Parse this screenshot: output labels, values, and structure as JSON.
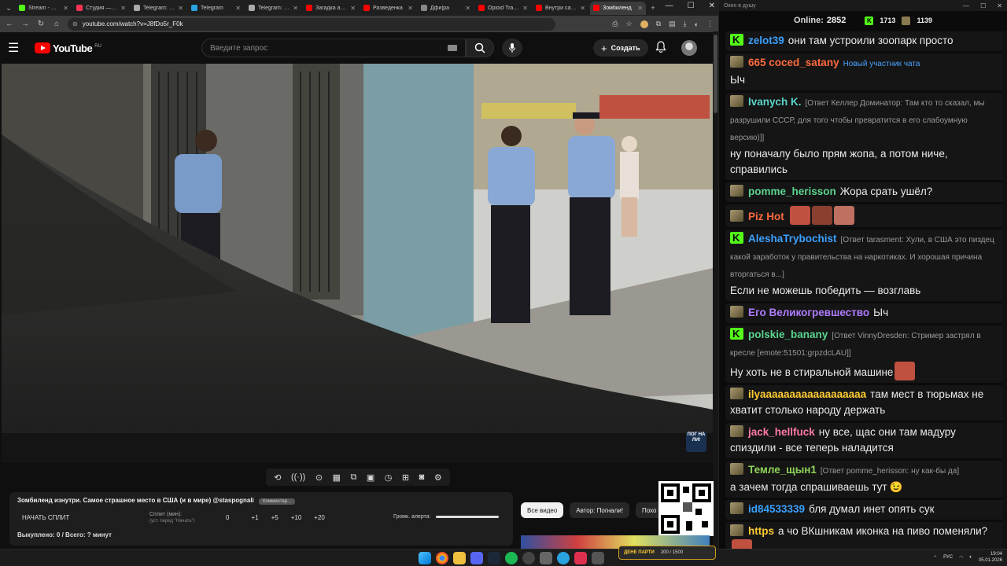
{
  "browser": {
    "tabs": [
      {
        "label": "Stream - Kick",
        "color": "#53fc18"
      },
      {
        "label": "Студия — YouTube",
        "color": "#ff3355"
      },
      {
        "label": "Telegram: View",
        "color": "#aaaaaa"
      },
      {
        "label": "Telegram",
        "color": "#2aa3e0"
      },
      {
        "label": "Telegram: View",
        "color": "#aaaaaa"
      },
      {
        "label": "Загадка арест",
        "color": "#ff0000"
      },
      {
        "label": "Разведенка",
        "color": "#ff0000"
      },
      {
        "label": "Дфи|ра",
        "color": "#888888"
      },
      {
        "label": "Opioid Tragedy",
        "color": "#ff0000"
      },
      {
        "label": "Внутри самой",
        "color": "#ff0000"
      },
      {
        "label": "Зомбиленд",
        "color": "#ff0000"
      }
    ],
    "url": "youtube.com/watch?v=J8fDo5r_F0k"
  },
  "youtube": {
    "region": "RU",
    "search_placeholder": "Введите запрос",
    "create_label": "Создать"
  },
  "video": {
    "watermark": "ПОГ НА ЛИ!"
  },
  "split": {
    "title": "Зомбиленд изнутри. Самое страшное место в США (и в мире) @staspognali",
    "badge": "Комментар...",
    "start_label": "НАЧАТЬ СПЛИТ",
    "split_label": "Сплит (мин):",
    "split_sub": "(уст. перед \"Начать\")",
    "values": [
      "0",
      "+1",
      "+5",
      "+10",
      "+20"
    ],
    "volume_label": "Громк. алерта:",
    "stats": "Выкуплено: 0 / Всего: ? минут"
  },
  "chips": [
    "Все видео",
    "Автор: Погнали!",
    "Похо"
  ],
  "overlay": {
    "name": "ДЕНЕ ПАРТИ",
    "progress": "200 / 1500"
  },
  "chat": {
    "window_title": "Окно в душу",
    "online_label": "Online:",
    "online_count": "2852",
    "kick_count": "1713",
    "other_count": "1139",
    "messages": [
      {
        "badge": "k",
        "user": "zelot39",
        "color": "#3aa0ff",
        "text": "они там устроили зоопарк просто"
      },
      {
        "badge": "sub",
        "user": "665 coced_satany",
        "color": "#ff6b3d",
        "note": "Новый участник чата",
        "text": "Ыч"
      },
      {
        "badge": "sub",
        "user": "Ivanych K.",
        "color": "#5ad4c8",
        "reply": "[Ответ Келлер Доминатор: Там кто то сказал, мы разрушили СССР, для того чтобы превратится в его слабоумную версию)]]",
        "text": "ну поначалу было прям жопа, а потом ниче, справились"
      },
      {
        "badge": "sub",
        "user": "pomme_herisson",
        "color": "#5ad48c",
        "text": "Жора срать ушёл?"
      },
      {
        "badge": "sub",
        "user": "Piz Hot",
        "color": "#ff6b3d",
        "text": "",
        "emotes": 3
      },
      {
        "badge": "k",
        "user": "AleshaTrybochist",
        "color": "#3aa0ff",
        "reply": "[Ответ tarasment: Хули, в США это пиздец какой заработок у правительства на наркотиках. И хорошая причина вторгаться в...]",
        "text": "Если не можешь победить — возглавь"
      },
      {
        "badge": "sub",
        "user": "Его Великогревшество",
        "color": "#b07cff",
        "text": "Ыч"
      },
      {
        "badge": "k",
        "user": "polskie_banany",
        "color": "#5ad48c",
        "reply": "[Ответ VinnyDresden: Стример застрял в кресле [emote:51501:grpzdcLAU]]",
        "text": "Ну хоть не в стиральной машине",
        "emotes": 1
      },
      {
        "badge": "sub",
        "user": "ilyaaaaaaaaaaaaaaaaaa",
        "color": "#ffcc33",
        "text": "там мест в тюрьмах не хватит столько народу держать"
      },
      {
        "badge": "sub",
        "user": "jack_hellfuck",
        "color": "#ff7aa8",
        "text": "ну все, щас они там мадуру спиздили - все теперь наладится"
      },
      {
        "badge": "sub",
        "user": "Темле_щын1",
        "color": "#8fd45a",
        "reply": "[Ответ pomme_herisson: ну как-бы да]",
        "text": "а зачем тогда спрашиваешь тут",
        "emoji": "😉"
      },
      {
        "badge": "sub",
        "user": "id84533339",
        "color": "#3aa0ff",
        "text": "бля думал инет опять сук"
      },
      {
        "badge": "sub",
        "user": "https",
        "color": "#ffcc33",
        "text": "а чо ВКшникам иконка на пиво поменяли?",
        "emotes": 1
      }
    ]
  },
  "taskbar": {
    "lang": "РУС",
    "time": "19:04",
    "date": "05.01.2026"
  }
}
